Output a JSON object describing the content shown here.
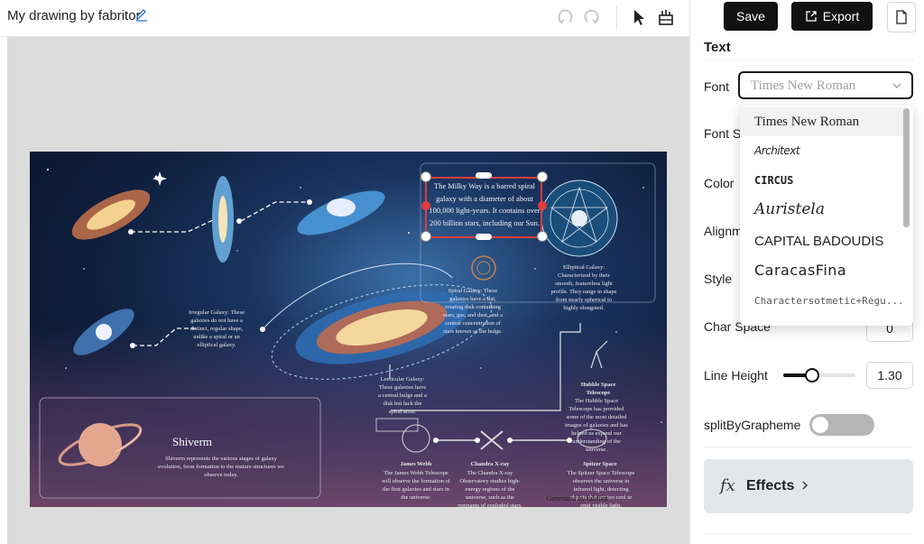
{
  "document": {
    "title": "My drawing by fabritor"
  },
  "toolbar": {
    "undo_icon": "undo-icon",
    "redo_icon": "redo-icon",
    "select_icon": "pointer-icon",
    "pan_icon": "pan-hand-icon"
  },
  "actions": {
    "save_label": "Save",
    "export_label": "Export",
    "page_icon": "file-icon"
  },
  "panel": {
    "title": "Text",
    "font_label": "Font",
    "font_size_label": "Font Si",
    "color_label": "Color",
    "alignment_label": "Alignm",
    "style_label": "Style",
    "char_space_label": "Char Space",
    "char_space_value": "0",
    "line_height_label": "Line Height",
    "line_height_value": "1.30",
    "line_height_level": 0.4,
    "split_label": "splitByGrapheme",
    "split_on": false,
    "effects_label": "Effects"
  },
  "font_select": {
    "value": "Times New Roman",
    "options": [
      "Times New Roman",
      "Architext",
      "CIRCUS",
      "Auristela",
      "CAPITAL BADOUDIS",
      "CaracasFina",
      "Charactersotmetic+Regu..."
    ]
  },
  "artboard": {
    "selected_text": "The Milky Way is a barred spiral galaxy with a diameter of about 100,000 light-years. It contains over 200 billion stars, including our Sun.",
    "elliptical": "Elliptical Galaxy: Characterized by their smooth, featureless light profile. They range in shape from nearly spherical to highly elongated.",
    "spiral": "Spiral Galaxy: These galaxies have a flat, rotating disk containing stars, gas, and dust, and a central concentration of stars known as the bulge.",
    "irregular": "Irregular Galaxy: These galaxies do not have a distinct, regular shape, unlike a spiral or an elliptical galaxy.",
    "lenticular": "Lenticular Galaxy: These galaxies have a central bulge and a disk but lack the spiral arms.",
    "hubble": "Hubble Space Telescope",
    "hubble_desc": "The Hubble Space Telescope has provided some of the most detailed images of galaxies and has helped us expand our understanding of the universe.",
    "card_title": "Shiverm",
    "card_desc": "Shiverm represents the various stages of galaxy evolution, from formation to the mature structures we observe today.",
    "webb": "James Webb",
    "webb_desc": "The James Webb Telescope will observe the formation of the first galaxies and stars in the universe.",
    "chandra": "Chandra X-ray",
    "chandra_desc": "The Chandra X-ray Observatory studies high-energy regions of the universe, such as the remnants of exploded stars.",
    "spitzer": "Spitzer Space",
    "spitzer_desc": "The Spitzer Space Telescope observes the universe in infrared light, detecting objects that are too cool to emit visible light.",
    "generated": "Generated by fabritor"
  }
}
